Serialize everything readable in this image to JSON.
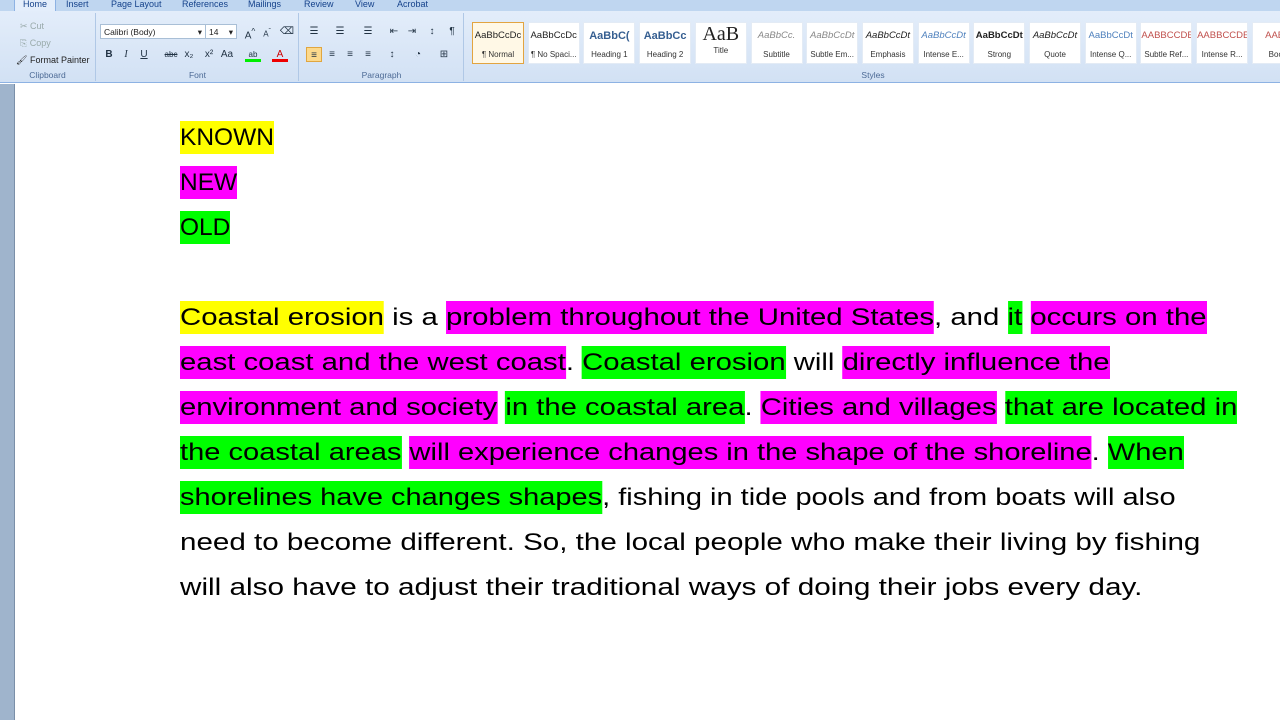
{
  "ribbon": {
    "tabs": [
      "Home",
      "Insert",
      "Page Layout",
      "References",
      "Mailings",
      "Review",
      "View",
      "Acrobat"
    ],
    "clipboard": {
      "cut": "Cut",
      "copy": "Copy",
      "format_painter": "Format Painter",
      "label": "Clipboard"
    },
    "font": {
      "name": "Calibri (Body)",
      "size": "14",
      "label": "Font"
    },
    "paragraph": {
      "label": "Paragraph"
    },
    "styles": {
      "label": "Styles",
      "items": [
        {
          "preview": "AaBbCcDc",
          "name": "¶ Normal",
          "selected": true
        },
        {
          "preview": "AaBbCcDc",
          "name": "¶ No Spaci..."
        },
        {
          "preview": "AaBbC(",
          "name": "Heading 1"
        },
        {
          "preview": "AaBbCc",
          "name": "Heading 2"
        },
        {
          "preview": "AaB",
          "name": "Title"
        },
        {
          "preview": "AaBbCc.",
          "name": "Subtitle"
        },
        {
          "preview": "AaBbCcDt",
          "name": "Subtle Em..."
        },
        {
          "preview": "AaBbCcDt",
          "name": "Emphasis"
        },
        {
          "preview": "AaBbCcDt",
          "name": "Intense E..."
        },
        {
          "preview": "AaBbCcDt",
          "name": "Strong"
        },
        {
          "preview": "AaBbCcDt",
          "name": "Quote"
        },
        {
          "preview": "AaBbCcDt",
          "name": "Intense Q..."
        },
        {
          "preview": "AABBCCDE",
          "name": "Subtle Ref..."
        },
        {
          "preview": "AABBCCDE",
          "name": "Intense R..."
        },
        {
          "preview": "AABB",
          "name": "Book"
        }
      ]
    }
  },
  "colors": {
    "Y": "#ffff00",
    "M": "#ff00ff",
    "G": "#00ff00"
  },
  "legend": [
    {
      "text": "KNOWN",
      "hl": "Y"
    },
    {
      "text": "NEW",
      "hl": "M"
    },
    {
      "text": "OLD",
      "hl": "G"
    }
  ],
  "paragraph_lines": [
    [
      {
        "t": "Coastal erosion",
        "hl": "Y"
      },
      {
        "t": " is a "
      },
      {
        "t": "problem throughout the United States",
        "hl": "M"
      },
      {
        "t": ", and "
      },
      {
        "t": "it",
        "hl": "G"
      },
      {
        "t": " "
      },
      {
        "t": "occurs on the",
        "hl": "M"
      }
    ],
    [
      {
        "t": "east coast and the west coast",
        "hl": "M"
      },
      {
        "t": ". "
      },
      {
        "t": "Coastal erosion",
        "hl": "G"
      },
      {
        "t": " will "
      },
      {
        "t": "directly influence the",
        "hl": "M"
      }
    ],
    [
      {
        "t": "environment and society",
        "hl": "M"
      },
      {
        "t": " "
      },
      {
        "t": "in the coastal area",
        "hl": "G"
      },
      {
        "t": ". "
      },
      {
        "t": "Cities and villages",
        "hl": "M"
      },
      {
        "t": " "
      },
      {
        "t": "that are located in",
        "hl": "G"
      }
    ],
    [
      {
        "t": "the coastal areas",
        "hl": "G"
      },
      {
        "t": " "
      },
      {
        "t": "will experience changes in the shape of the shoreline",
        "hl": "M"
      },
      {
        "t": ". "
      },
      {
        "t": "When",
        "hl": "G"
      }
    ],
    [
      {
        "t": "shorelines have changes shapes",
        "hl": "G"
      },
      {
        "t": ", fishing in tide pools and from boats will also"
      }
    ],
    [
      {
        "t": "need to become different. So, the local people who make their living by fishing"
      }
    ],
    [
      {
        "t": "will also have to adjust their traditional ways of doing their jobs every day."
      }
    ]
  ]
}
